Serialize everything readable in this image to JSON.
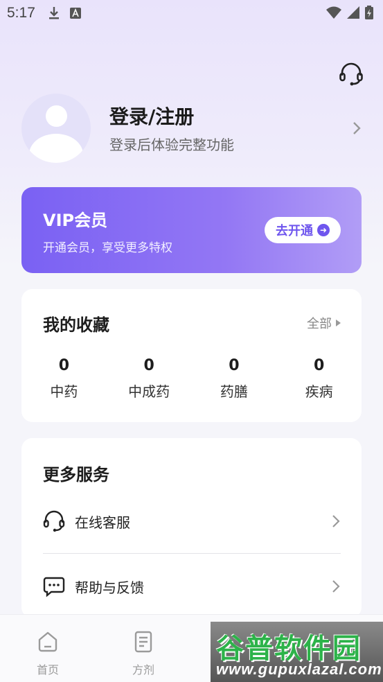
{
  "status_bar": {
    "time": "5:17"
  },
  "profile": {
    "title": "登录/注册",
    "subtitle": "登录后体验完整功能"
  },
  "vip": {
    "title": "VIP会员",
    "subtitle": "开通会员，享受更多特权",
    "button": "去开通"
  },
  "favorites": {
    "title": "我的收藏",
    "all": "全部",
    "items": [
      {
        "count": "0",
        "label": "中药"
      },
      {
        "count": "0",
        "label": "中成药"
      },
      {
        "count": "0",
        "label": "药膳"
      },
      {
        "count": "0",
        "label": "疾病"
      }
    ]
  },
  "services": {
    "title": "更多服务",
    "items": [
      {
        "label": "在线客服",
        "icon": "headset-icon"
      },
      {
        "label": "帮助与反馈",
        "icon": "chat-bubble-icon"
      }
    ]
  },
  "tabbar": {
    "items": [
      {
        "label": "首页",
        "icon": "home-icon"
      },
      {
        "label": "方剂",
        "icon": "document-icon"
      }
    ]
  },
  "watermark": {
    "title": "谷普软件园",
    "url": "www.gupuxlazal.com"
  },
  "colors": {
    "accent": "#7a61f3",
    "background": "#f5f5fa"
  }
}
